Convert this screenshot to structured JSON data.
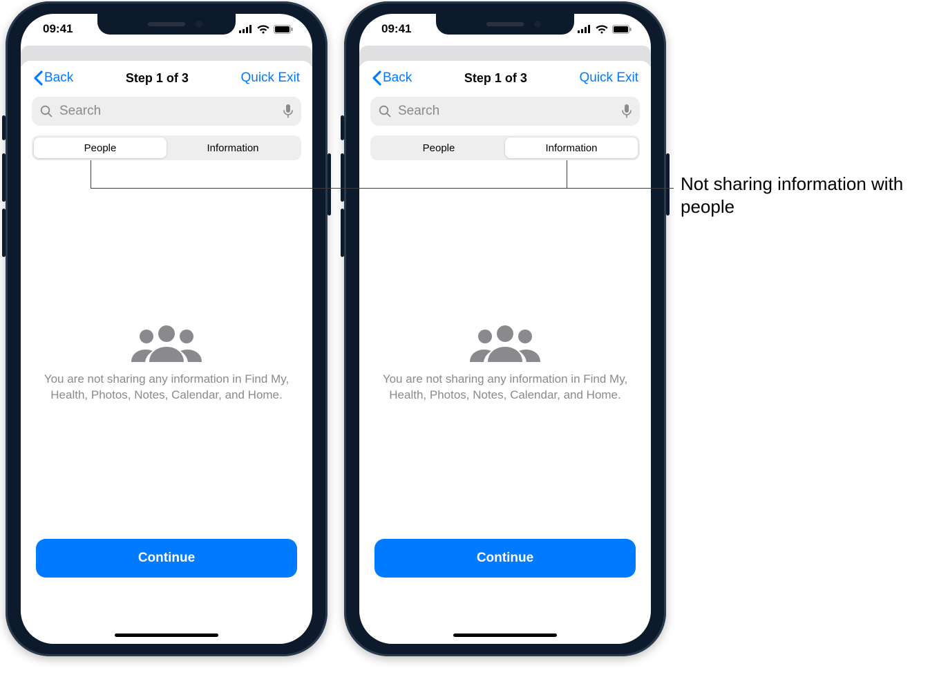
{
  "status": {
    "time": "09:41"
  },
  "nav": {
    "back": "Back",
    "title": "Step 1 of 3",
    "quick_exit": "Quick Exit"
  },
  "search": {
    "placeholder": "Search"
  },
  "segments": {
    "people": "People",
    "information": "Information"
  },
  "empty": {
    "message": "You are not sharing any information in Find My, Health, Photos, Notes, Calendar, and Home."
  },
  "cta": {
    "continue": "Continue"
  },
  "callout": {
    "text": "Not sharing information with people"
  }
}
